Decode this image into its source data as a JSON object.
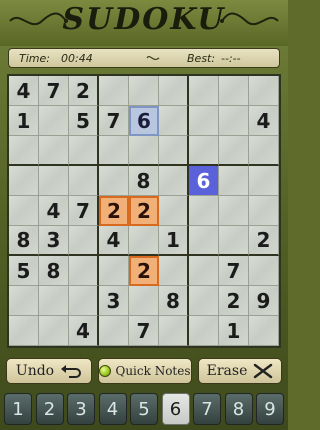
{
  "header": {
    "title": "SUDOKU"
  },
  "timebar": {
    "time_label": "Time:",
    "time_value": "00:44",
    "best_label": "Best:",
    "best_value": "--:--"
  },
  "grid": {
    "rows": [
      [
        "4",
        "7",
        "2",
        "",
        "",
        "",
        "",
        "",
        ""
      ],
      [
        "1",
        "",
        "5",
        "7",
        "6",
        "",
        "",
        "",
        "4"
      ],
      [
        "",
        "",
        "",
        "",
        "",
        "",
        "",
        "",
        ""
      ],
      [
        "",
        "",
        "",
        "",
        "8",
        "",
        "6",
        "",
        ""
      ],
      [
        "",
        "4",
        "7",
        "2",
        "2",
        "",
        "",
        "",
        ""
      ],
      [
        "8",
        "3",
        "",
        "4",
        "",
        "1",
        "",
        "",
        "2"
      ],
      [
        "5",
        "8",
        "",
        "",
        "2",
        "",
        "",
        "7",
        ""
      ],
      [
        "",
        "",
        "",
        "3",
        "",
        "8",
        "",
        "2",
        "9"
      ],
      [
        "",
        "",
        "4",
        "",
        "7",
        "",
        "",
        "1",
        ""
      ]
    ],
    "highlights": {
      "1-4": "sel-blue",
      "3-6": "sel-blue-strong",
      "4-3": "conflict",
      "4-4": "conflict",
      "6-4": "conflict"
    }
  },
  "actions": {
    "undo_label": "Undo",
    "notes_label": "Quick Notes",
    "erase_label": "Erase"
  },
  "numbers": [
    "1",
    "2",
    "3",
    "4",
    "5",
    "6",
    "7",
    "8",
    "9"
  ],
  "active_number": "6"
}
